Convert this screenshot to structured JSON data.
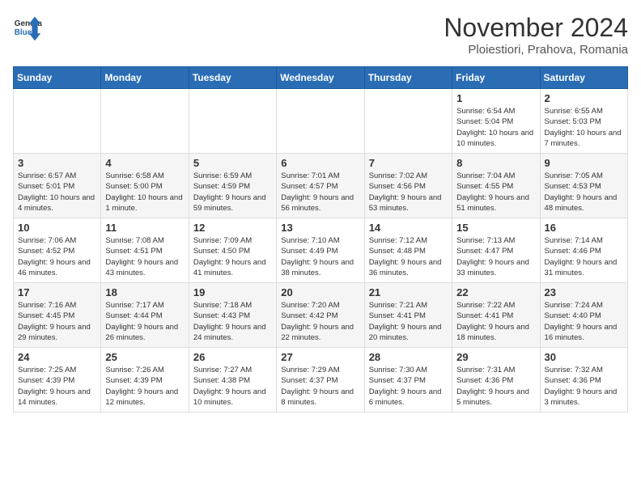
{
  "logo": {
    "general": "General",
    "blue": "Blue"
  },
  "title": "November 2024",
  "location": "Ploiestiori, Prahova, Romania",
  "days_header": [
    "Sunday",
    "Monday",
    "Tuesday",
    "Wednesday",
    "Thursday",
    "Friday",
    "Saturday"
  ],
  "weeks": [
    [
      {
        "day": "",
        "info": ""
      },
      {
        "day": "",
        "info": ""
      },
      {
        "day": "",
        "info": ""
      },
      {
        "day": "",
        "info": ""
      },
      {
        "day": "",
        "info": ""
      },
      {
        "day": "1",
        "info": "Sunrise: 6:54 AM\nSunset: 5:04 PM\nDaylight: 10 hours and 10 minutes."
      },
      {
        "day": "2",
        "info": "Sunrise: 6:55 AM\nSunset: 5:03 PM\nDaylight: 10 hours and 7 minutes."
      }
    ],
    [
      {
        "day": "3",
        "info": "Sunrise: 6:57 AM\nSunset: 5:01 PM\nDaylight: 10 hours and 4 minutes."
      },
      {
        "day": "4",
        "info": "Sunrise: 6:58 AM\nSunset: 5:00 PM\nDaylight: 10 hours and 1 minute."
      },
      {
        "day": "5",
        "info": "Sunrise: 6:59 AM\nSunset: 4:59 PM\nDaylight: 9 hours and 59 minutes."
      },
      {
        "day": "6",
        "info": "Sunrise: 7:01 AM\nSunset: 4:57 PM\nDaylight: 9 hours and 56 minutes."
      },
      {
        "day": "7",
        "info": "Sunrise: 7:02 AM\nSunset: 4:56 PM\nDaylight: 9 hours and 53 minutes."
      },
      {
        "day": "8",
        "info": "Sunrise: 7:04 AM\nSunset: 4:55 PM\nDaylight: 9 hours and 51 minutes."
      },
      {
        "day": "9",
        "info": "Sunrise: 7:05 AM\nSunset: 4:53 PM\nDaylight: 9 hours and 48 minutes."
      }
    ],
    [
      {
        "day": "10",
        "info": "Sunrise: 7:06 AM\nSunset: 4:52 PM\nDaylight: 9 hours and 46 minutes."
      },
      {
        "day": "11",
        "info": "Sunrise: 7:08 AM\nSunset: 4:51 PM\nDaylight: 9 hours and 43 minutes."
      },
      {
        "day": "12",
        "info": "Sunrise: 7:09 AM\nSunset: 4:50 PM\nDaylight: 9 hours and 41 minutes."
      },
      {
        "day": "13",
        "info": "Sunrise: 7:10 AM\nSunset: 4:49 PM\nDaylight: 9 hours and 38 minutes."
      },
      {
        "day": "14",
        "info": "Sunrise: 7:12 AM\nSunset: 4:48 PM\nDaylight: 9 hours and 36 minutes."
      },
      {
        "day": "15",
        "info": "Sunrise: 7:13 AM\nSunset: 4:47 PM\nDaylight: 9 hours and 33 minutes."
      },
      {
        "day": "16",
        "info": "Sunrise: 7:14 AM\nSunset: 4:46 PM\nDaylight: 9 hours and 31 minutes."
      }
    ],
    [
      {
        "day": "17",
        "info": "Sunrise: 7:16 AM\nSunset: 4:45 PM\nDaylight: 9 hours and 29 minutes."
      },
      {
        "day": "18",
        "info": "Sunrise: 7:17 AM\nSunset: 4:44 PM\nDaylight: 9 hours and 26 minutes."
      },
      {
        "day": "19",
        "info": "Sunrise: 7:18 AM\nSunset: 4:43 PM\nDaylight: 9 hours and 24 minutes."
      },
      {
        "day": "20",
        "info": "Sunrise: 7:20 AM\nSunset: 4:42 PM\nDaylight: 9 hours and 22 minutes."
      },
      {
        "day": "21",
        "info": "Sunrise: 7:21 AM\nSunset: 4:41 PM\nDaylight: 9 hours and 20 minutes."
      },
      {
        "day": "22",
        "info": "Sunrise: 7:22 AM\nSunset: 4:41 PM\nDaylight: 9 hours and 18 minutes."
      },
      {
        "day": "23",
        "info": "Sunrise: 7:24 AM\nSunset: 4:40 PM\nDaylight: 9 hours and 16 minutes."
      }
    ],
    [
      {
        "day": "24",
        "info": "Sunrise: 7:25 AM\nSunset: 4:39 PM\nDaylight: 9 hours and 14 minutes."
      },
      {
        "day": "25",
        "info": "Sunrise: 7:26 AM\nSunset: 4:39 PM\nDaylight: 9 hours and 12 minutes."
      },
      {
        "day": "26",
        "info": "Sunrise: 7:27 AM\nSunset: 4:38 PM\nDaylight: 9 hours and 10 minutes."
      },
      {
        "day": "27",
        "info": "Sunrise: 7:29 AM\nSunset: 4:37 PM\nDaylight: 9 hours and 8 minutes."
      },
      {
        "day": "28",
        "info": "Sunrise: 7:30 AM\nSunset: 4:37 PM\nDaylight: 9 hours and 6 minutes."
      },
      {
        "day": "29",
        "info": "Sunrise: 7:31 AM\nSunset: 4:36 PM\nDaylight: 9 hours and 5 minutes."
      },
      {
        "day": "30",
        "info": "Sunrise: 7:32 AM\nSunset: 4:36 PM\nDaylight: 9 hours and 3 minutes."
      }
    ]
  ]
}
